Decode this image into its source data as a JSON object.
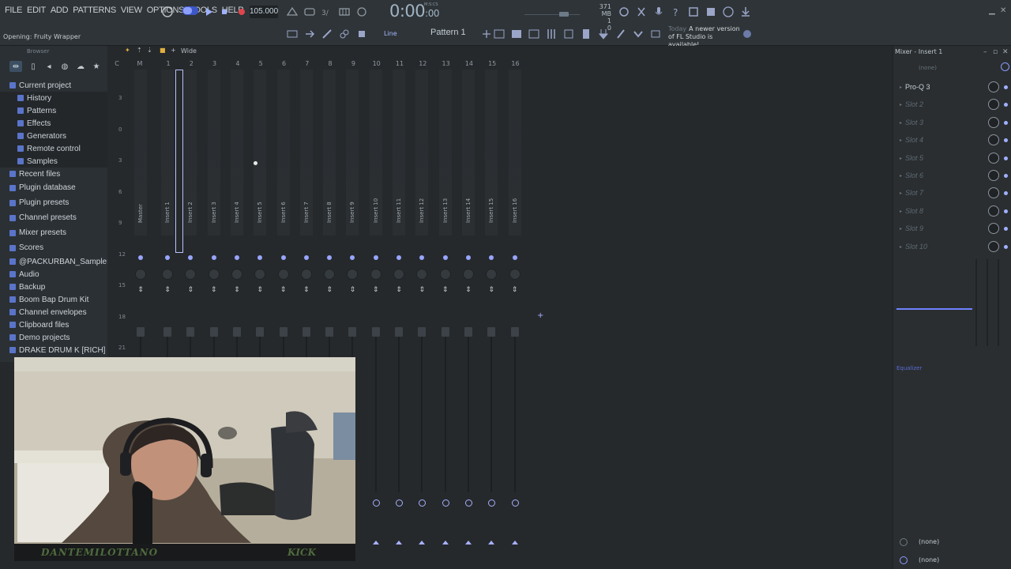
{
  "menu": [
    "FILE",
    "EDIT",
    "ADD",
    "PATTERNS",
    "VIEW",
    "OPTIONS",
    "TOOLS",
    "HELP"
  ],
  "hint": "Opening: Fruity Wrapper",
  "tempo": "105.000",
  "time": {
    "main": "0:00",
    "sub": ":00",
    "unit": "M:S:CS"
  },
  "cpu": {
    "mem": "371 MB",
    "val1": "1",
    "val2": "0"
  },
  "pattern": "Pattern 1",
  "snap": "Line",
  "news": {
    "label": "Today",
    "text": "A newer version of FL Studio is available!"
  },
  "browser": {
    "title": "Browser",
    "items": [
      {
        "label": "Current project",
        "level": "top"
      },
      {
        "label": "History",
        "level": "sub"
      },
      {
        "label": "Patterns",
        "level": "sub"
      },
      {
        "label": "Effects",
        "level": "sub"
      },
      {
        "label": "Generators",
        "level": "sub"
      },
      {
        "label": "Remote control",
        "level": "sub"
      },
      {
        "label": "Samples",
        "level": "sub"
      },
      {
        "label": "Recent files",
        "level": "top"
      },
      {
        "label": "Plugin database",
        "level": "big"
      },
      {
        "label": "Plugin presets",
        "level": "big"
      },
      {
        "label": "Channel presets",
        "level": "big"
      },
      {
        "label": "Mixer presets",
        "level": "big"
      },
      {
        "label": "Scores",
        "level": "big"
      },
      {
        "label": "@PACKURBAN_SamplePacks",
        "level": "top"
      },
      {
        "label": "Audio",
        "level": "top"
      },
      {
        "label": "Backup",
        "level": "top"
      },
      {
        "label": "Boom Bap Drum Kit",
        "level": "top"
      },
      {
        "label": "Channel envelopes",
        "level": "top"
      },
      {
        "label": "Clipboard files",
        "level": "top"
      },
      {
        "label": "Demo projects",
        "level": "top"
      },
      {
        "label": "DRAKE DRUM K [RICH] 2023",
        "level": "top"
      }
    ]
  },
  "mixer": {
    "view": "Wide",
    "ticks": [
      "C",
      "M",
      "1",
      "2",
      "3",
      "4",
      "5",
      "6",
      "7",
      "8",
      "9",
      "10",
      "11",
      "12",
      "13",
      "14",
      "15",
      "16"
    ],
    "tracks": [
      "Master",
      "Insert 1",
      "Insert 2",
      "Insert 3",
      "Insert 4",
      "Insert 5",
      "Insert 6",
      "Insert 7",
      "Insert 8",
      "Insert 9",
      "Insert 10",
      "Insert 11",
      "Insert 12",
      "Insert 13",
      "Insert 14",
      "Insert 15",
      "Insert 16"
    ],
    "db_marks": [
      "3",
      "0",
      "3",
      "6",
      "9",
      "12",
      "15",
      "18",
      "21"
    ]
  },
  "insert_panel": {
    "title": "Mixer - Insert 1",
    "input": "(none)",
    "slots": [
      "Pro-Q 3",
      "Slot 2",
      "Slot 3",
      "Slot 4",
      "Slot 5",
      "Slot 6",
      "Slot 7",
      "Slot 8",
      "Slot 9",
      "Slot 10"
    ],
    "eq": "Equalizer",
    "out1": "(none)",
    "out2": "(none)"
  },
  "webcam": {
    "name": "DANTEMILOTTANO",
    "tag": "KICK"
  },
  "colors": {
    "accent": "#a7b1ff",
    "bg": "#26292c",
    "toolbar": "#2f3438"
  }
}
